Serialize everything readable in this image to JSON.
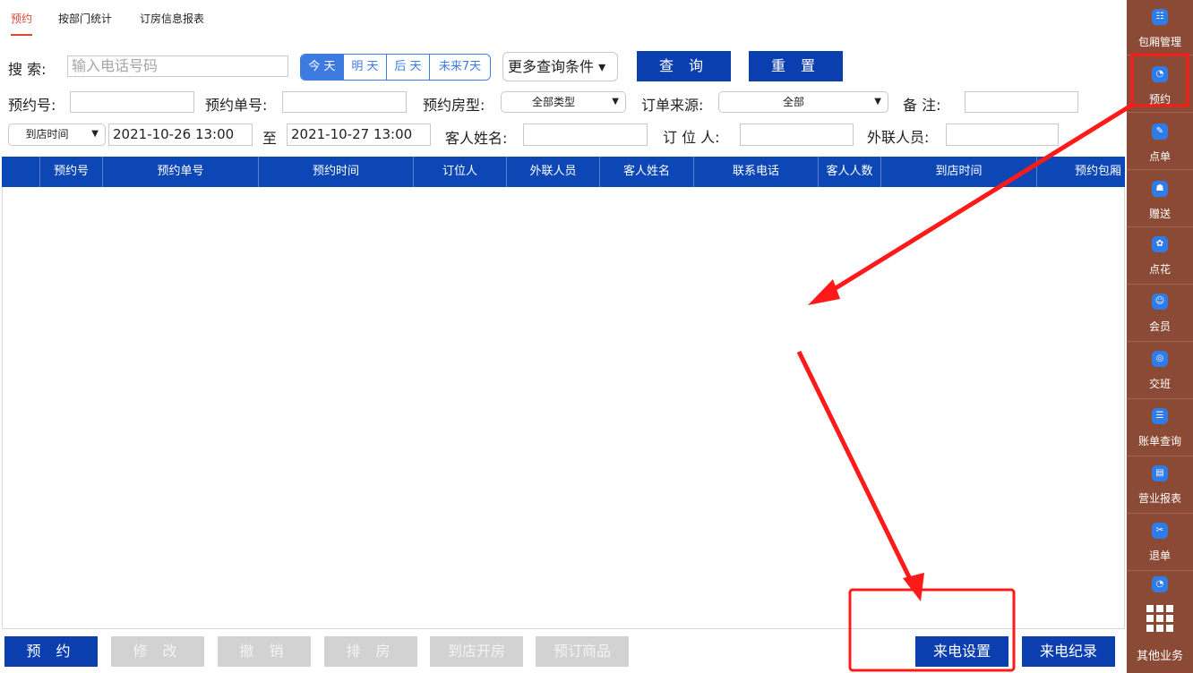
{
  "tabs": [
    "预约",
    "按部门统计",
    "订房信息报表"
  ],
  "search": {
    "label": "搜  索:",
    "placeholder": "输入电话号码"
  },
  "day_buttons": [
    "今 天",
    "明 天",
    "后 天",
    "未来7天"
  ],
  "more_conditions": "更多查询条件 ▾",
  "query_button": "查 询",
  "reset_button": "重 置",
  "row2": {
    "booking_no": "预约号:",
    "booking_order_no": "预约单号:",
    "room_type": "预约房型:",
    "room_type_value": "全部类型",
    "order_source": "订单来源:",
    "order_source_value": "全部",
    "remark": "备  注:"
  },
  "row3": {
    "time_type": "到店时间",
    "start_time": "2021-10-26 13:00",
    "to": "至",
    "end_time": "2021-10-27 13:00",
    "guest_name": "客人姓名:",
    "booker": "订 位 人:",
    "liaison": "外联人员:"
  },
  "table_headers": [
    "预约号",
    "预约单号",
    "预约时间",
    "订位人",
    "外联人员",
    "客人姓名",
    "联系电话",
    "客人人数",
    "到店时间",
    "预约包厢"
  ],
  "bottom_buttons": {
    "book": "预 约",
    "edit": "修 改",
    "revoke": "撤 销",
    "arrange": "排 房",
    "open_room": "到店开房",
    "preorder": "预订商品",
    "call_settings": "来电设置",
    "call_log": "来电纪录"
  },
  "sidebar": [
    {
      "label": "包厢管理",
      "icon": "grid-list-icon"
    },
    {
      "label": "预约",
      "icon": "booking-icon"
    },
    {
      "label": "点单",
      "icon": "order-icon"
    },
    {
      "label": "赠送",
      "icon": "gift-icon"
    },
    {
      "label": "点花",
      "icon": "flower-icon"
    },
    {
      "label": "会员",
      "icon": "member-icon"
    },
    {
      "label": "交班",
      "icon": "shift-icon"
    },
    {
      "label": "账单查询",
      "icon": "bill-search-icon"
    },
    {
      "label": "营业报表",
      "icon": "report-icon"
    },
    {
      "label": "退单",
      "icon": "refund-icon"
    }
  ],
  "sidebar_other": "其他业务",
  "colors": {
    "primary": "#0b3fb0",
    "accent_red": "#e0453a",
    "sidebar_bg": "#8b4a35",
    "annotation": "#ff1a1a"
  }
}
